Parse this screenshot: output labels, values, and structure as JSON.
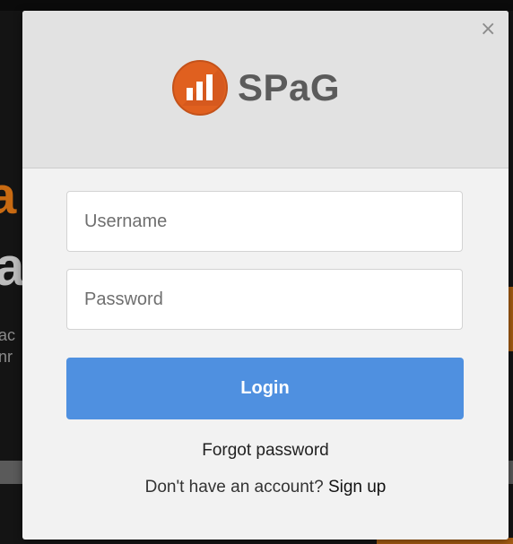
{
  "modal": {
    "close_glyph": "×",
    "logo_text": "SPaG",
    "username_placeholder": "Username",
    "password_placeholder": "Password",
    "login_label": "Login",
    "forgot_label": "Forgot password",
    "signup_prompt": "Don't have an account?",
    "signup_label": "Sign up"
  },
  "colors": {
    "brand_orange": "#e0601f",
    "login_blue": "#4f90e0",
    "header_gray": "#e2e2e2"
  }
}
